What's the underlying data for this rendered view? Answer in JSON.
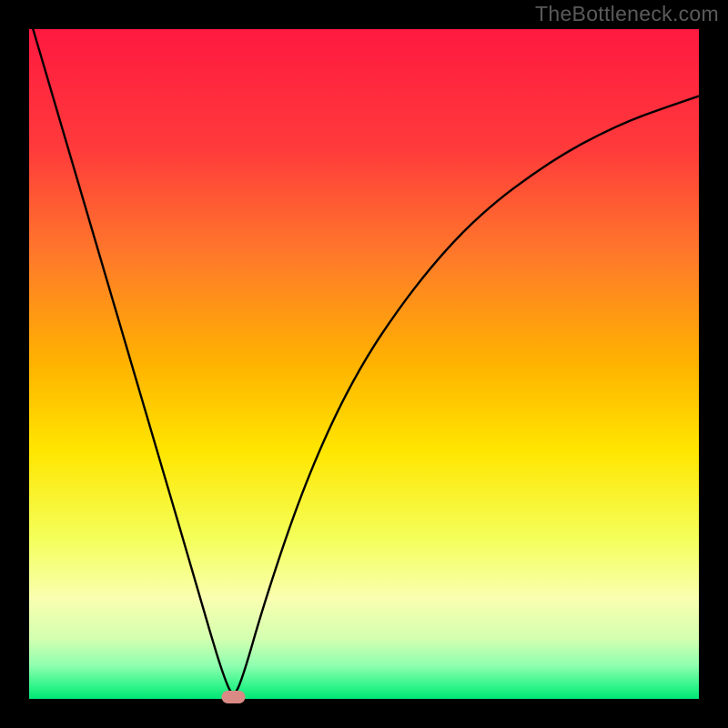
{
  "watermark": "TheBottleneck.com",
  "chart_data": {
    "type": "line",
    "title": "",
    "xlabel": "",
    "ylabel": "",
    "xlim": [
      0,
      100
    ],
    "ylim": [
      0,
      100
    ],
    "x": [
      0,
      5,
      10,
      15,
      20,
      25,
      27,
      29,
      30.5,
      32,
      35,
      40,
      45,
      50,
      55,
      60,
      65,
      70,
      75,
      80,
      85,
      90,
      95,
      100
    ],
    "values": [
      102,
      85,
      68,
      51,
      34,
      17,
      10,
      3.5,
      0,
      3.5,
      14,
      29,
      41,
      50.5,
      58,
      64.5,
      70,
      74.5,
      78.2,
      81.5,
      84.2,
      86.5,
      88.3,
      90
    ],
    "min_point": {
      "x": 30.5,
      "y": 0
    },
    "annotations": [],
    "background": "rainbow-gradient",
    "grid": false,
    "legend": false
  },
  "colors": {
    "frame": "#000000",
    "gradient_top": "#ff1940",
    "gradient_mid_upper": "#ff7a2a",
    "gradient_mid": "#ffd600",
    "gradient_mid_lower": "#f7ff6e",
    "gradient_lower": "#c8ff90",
    "gradient_bottom": "#00e676",
    "curve": "#000000",
    "marker_fill": "#d98a84",
    "marker_stroke": "#c46e66"
  }
}
